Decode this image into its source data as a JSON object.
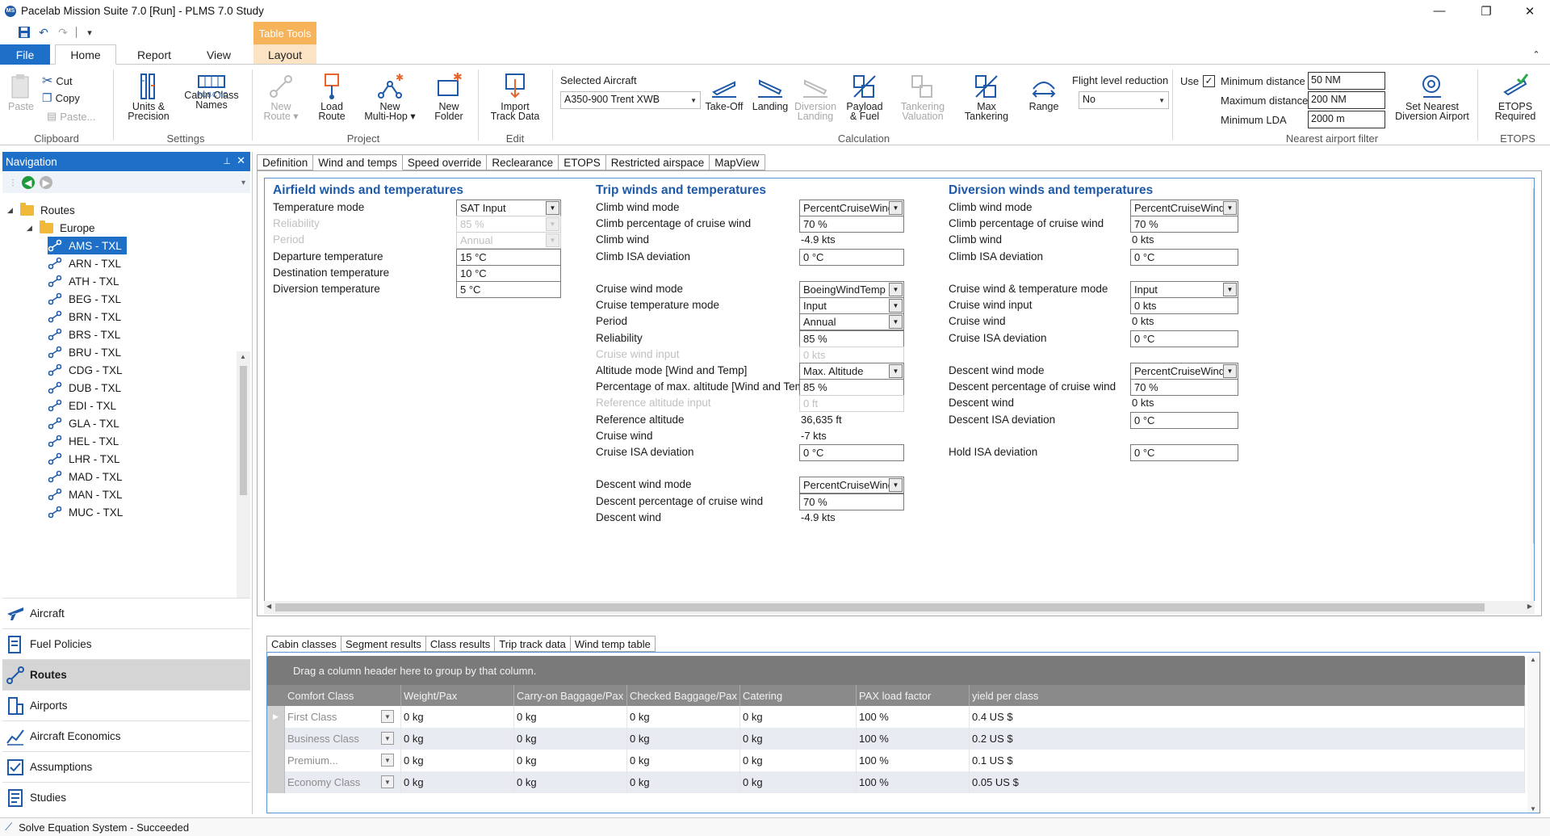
{
  "window": {
    "title": "Pacelab Mission Suite 7.0 [Run] - PLMS 7.0 Study",
    "logo_text": "MS",
    "minimize": "—",
    "maximize": "❐",
    "close": "✕"
  },
  "ribbon_tabs": {
    "file": "File",
    "home": "Home",
    "report": "Report",
    "view": "View",
    "table_tools": "Table Tools",
    "layout": "Layout"
  },
  "clipboard": {
    "paste": "Paste",
    "cut": "Cut",
    "copy": "Copy",
    "paste_small": "Paste...",
    "group": "Clipboard"
  },
  "settings": {
    "units_1": "Units &",
    "units_2": "Precision",
    "cabin_1": "Cabin Class",
    "cabin_2": "Names",
    "cabin_icon_text": "FCBCYC",
    "group": "Settings"
  },
  "project": {
    "new_route_1": "New",
    "new_route_2": "Route ▾",
    "load_route_1": "Load",
    "load_route_2": "Route",
    "multihop_1": "New",
    "multihop_2": "Multi-Hop ▾",
    "folder_1": "New",
    "folder_2": "Folder",
    "group": "Project"
  },
  "edit": {
    "import_1": "Import",
    "import_2": "Track Data",
    "group": "Edit"
  },
  "calculation": {
    "selected_aircraft_label": "Selected Aircraft",
    "selected_aircraft_value": "A350-900 Trent XWB",
    "takeoff": "Take-Off",
    "landing": "Landing",
    "diversion_1": "Diversion",
    "diversion_2": "Landing",
    "payload_1": "Payload",
    "payload_2": "& Fuel",
    "tankering_1": "Tankering",
    "tankering_2": "Valuation",
    "max_tank_1": "Max",
    "max_tank_2": "Tankering",
    "range": "Range",
    "flr_label": "Flight level reduction",
    "flr_value": "No",
    "group": "Calculation"
  },
  "nearest": {
    "use_label": "Use",
    "use_checked": "✓",
    "min_distance_label": "Minimum distance",
    "min_distance_value": "50 NM",
    "max_distance_label": "Maximum distance",
    "max_distance_value": "200 NM",
    "min_lda_label": "Minimum LDA",
    "min_lda_value": "2000 m",
    "set_nearest_1": "Set Nearest",
    "set_nearest_2": "Diversion Airport",
    "group": "Nearest airport filter"
  },
  "etops_group": {
    "btn_1": "ETOPS",
    "btn_2": "Required",
    "group": "ETOPS"
  },
  "navigation": {
    "title": "Navigation",
    "pin": "📌",
    "close": "✕",
    "back": "◀",
    "forward": "▶",
    "routes_root": "Routes",
    "europe": "Europe",
    "routes": [
      "AMS - TXL",
      "ARN - TXL",
      "ATH - TXL",
      "BEG - TXL",
      "BRN - TXL",
      "BRS - TXL",
      "BRU - TXL",
      "CDG - TXL",
      "DUB - TXL",
      "EDI - TXL",
      "GLA - TXL",
      "HEL - TXL",
      "LHR - TXL",
      "MAD - TXL",
      "MAN - TXL",
      "MUC - TXL"
    ],
    "sections": [
      "Aircraft",
      "Fuel Policies",
      "Routes",
      "Airports",
      "Aircraft Economics",
      "Assumptions",
      "Studies"
    ]
  },
  "subtabs": [
    "Definition",
    "Wind and temps",
    "Speed override",
    "Reclearance",
    "ETOPS",
    "Restricted airspace",
    "MapView"
  ],
  "airfield": {
    "title": "Airfield winds and temperatures",
    "temperature_mode": {
      "label": "Temperature mode",
      "value": "SAT Input"
    },
    "reliability": {
      "label": "Reliability",
      "value": "85 %"
    },
    "period": {
      "label": "Period",
      "value": "Annual"
    },
    "departure_temp": {
      "label": "Departure temperature",
      "value": "15 °C"
    },
    "destination_temp": {
      "label": "Destination temperature",
      "value": "10 °C"
    },
    "diversion_temp": {
      "label": "Diversion temperature",
      "value": "5 °C"
    }
  },
  "trip": {
    "title": "Trip winds and temperatures",
    "climb_wind_mode": {
      "label": "Climb wind mode",
      "value": "PercentCruiseWind"
    },
    "climb_pct": {
      "label": "Climb percentage of cruise wind",
      "value": "70 %"
    },
    "climb_wind": {
      "label": "Climb wind",
      "value": "-4.9 kts"
    },
    "climb_isa": {
      "label": "Climb ISA deviation",
      "value": "0 °C"
    },
    "cruise_wind_mode": {
      "label": "Cruise wind mode",
      "value": "BoeingWindTemp"
    },
    "cruise_temp_mode": {
      "label": "Cruise temperature mode",
      "value": "Input"
    },
    "period": {
      "label": "Period",
      "value": "Annual"
    },
    "reliability": {
      "label": "Reliability",
      "value": "85 %"
    },
    "cruise_wind_input": {
      "label": "Cruise wind input",
      "value": "0 kts"
    },
    "altitude_mode": {
      "label": "Altitude mode [Wind and Temp]",
      "value": "Max. Altitude"
    },
    "pct_max_alt": {
      "label": "Percentage of max. altitude [Wind and Temp]",
      "value": "85 %"
    },
    "ref_alt_input": {
      "label": "Reference altitude input",
      "value": "0 ft"
    },
    "ref_alt": {
      "label": "Reference altitude",
      "value": "36,635 ft"
    },
    "cruise_wind": {
      "label": "Cruise wind",
      "value": "-7 kts"
    },
    "cruise_isa": {
      "label": "Cruise ISA deviation",
      "value": "0 °C"
    },
    "descent_wind_mode": {
      "label": "Descent wind mode",
      "value": "PercentCruiseWind"
    },
    "descent_pct": {
      "label": "Descent percentage of cruise wind",
      "value": "70 %"
    },
    "descent_wind": {
      "label": "Descent wind",
      "value": "-4.9 kts"
    }
  },
  "diversion": {
    "title": "Diversion winds and temperatures",
    "climb_wind_mode": {
      "label": "Climb wind mode",
      "value": "PercentCruiseWind"
    },
    "climb_pct": {
      "label": "Climb percentage of cruise wind",
      "value": "70 %"
    },
    "climb_wind": {
      "label": "Climb wind",
      "value": "0 kts"
    },
    "climb_isa": {
      "label": "Climb ISA deviation",
      "value": "0 °C"
    },
    "cruise_wt_mode": {
      "label": "Cruise wind & temperature mode",
      "value": "Input"
    },
    "cruise_wind_input": {
      "label": "Cruise wind input",
      "value": "0 kts"
    },
    "cruise_wind": {
      "label": "Cruise wind",
      "value": "0 kts"
    },
    "cruise_isa": {
      "label": "Cruise ISA deviation",
      "value": "0 °C"
    },
    "descent_wind_mode": {
      "label": "Descent wind mode",
      "value": "PercentCruiseWind"
    },
    "descent_pct": {
      "label": "Descent percentage of cruise wind",
      "value": "70 %"
    },
    "descent_wind": {
      "label": "Descent wind",
      "value": "0 kts"
    },
    "descent_isa": {
      "label": "Descent ISA deviation",
      "value": "0 °C"
    },
    "hold_isa": {
      "label": "Hold ISA deviation",
      "value": "0 °C"
    }
  },
  "bottom_tabs": [
    "Cabin classes",
    "Segment results",
    "Class results",
    "Trip track data",
    "Wind temp table"
  ],
  "cabin_grid": {
    "group_hint": "Drag a column header here to group by that column.",
    "columns": [
      "Comfort Class",
      "Weight/Pax",
      "Carry-on Baggage/Pax",
      "Checked Baggage/Pax",
      "Catering",
      "PAX load factor",
      "yield per class"
    ],
    "rows": [
      [
        "First Class",
        "0 kg",
        "0 kg",
        "0 kg",
        "0 kg",
        "100 %",
        "0.4 US $"
      ],
      [
        "Business Class",
        "0 kg",
        "0 kg",
        "0 kg",
        "0 kg",
        "100 %",
        "0.2 US $"
      ],
      [
        "Premium...",
        "0 kg",
        "0 kg",
        "0 kg",
        "0 kg",
        "100 %",
        "0.1 US $"
      ],
      [
        "Economy Class",
        "0 kg",
        "0 kg",
        "0 kg",
        "0 kg",
        "100 %",
        "0.05 US $"
      ]
    ]
  },
  "status": {
    "text": "Solve Equation System - Succeeded"
  }
}
